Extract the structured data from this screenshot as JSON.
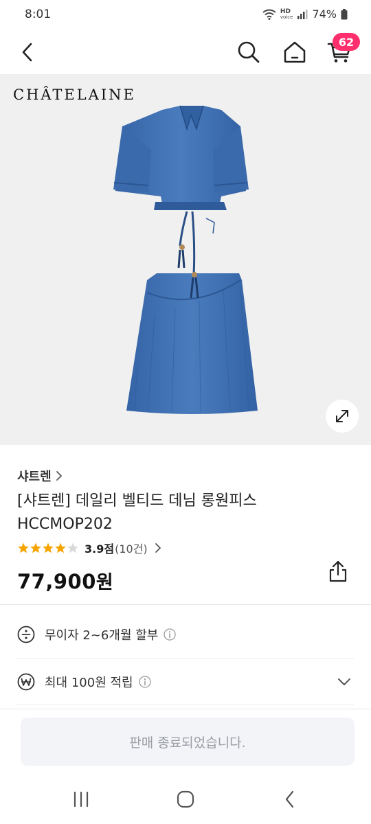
{
  "status": {
    "time": "8:01",
    "hd": "HD",
    "voice": "voice",
    "battery": "74%"
  },
  "cart": {
    "count": "62"
  },
  "hero": {
    "brand_logo": "CHÂTELAINE"
  },
  "product": {
    "seller": "샤트렌",
    "title": "[샤트렌] 데일리 벨티드 데님 롱원피스 HCCMOP202",
    "rating": 3.9,
    "rating_label": "3.9점",
    "review_count": "(10건)",
    "price_value": "77,900",
    "price_unit": "원"
  },
  "benefits": [
    {
      "icon": "installment-icon",
      "text": "무이자 2~6개월 할부"
    },
    {
      "icon": "won-point-icon",
      "text": "최대 100원 적립"
    }
  ],
  "sold_out_label": "판매 종료되었습니다.",
  "colors": {
    "badge": "#ff2e6d",
    "star": "#f6a400",
    "denim": "#3f6fb0"
  }
}
